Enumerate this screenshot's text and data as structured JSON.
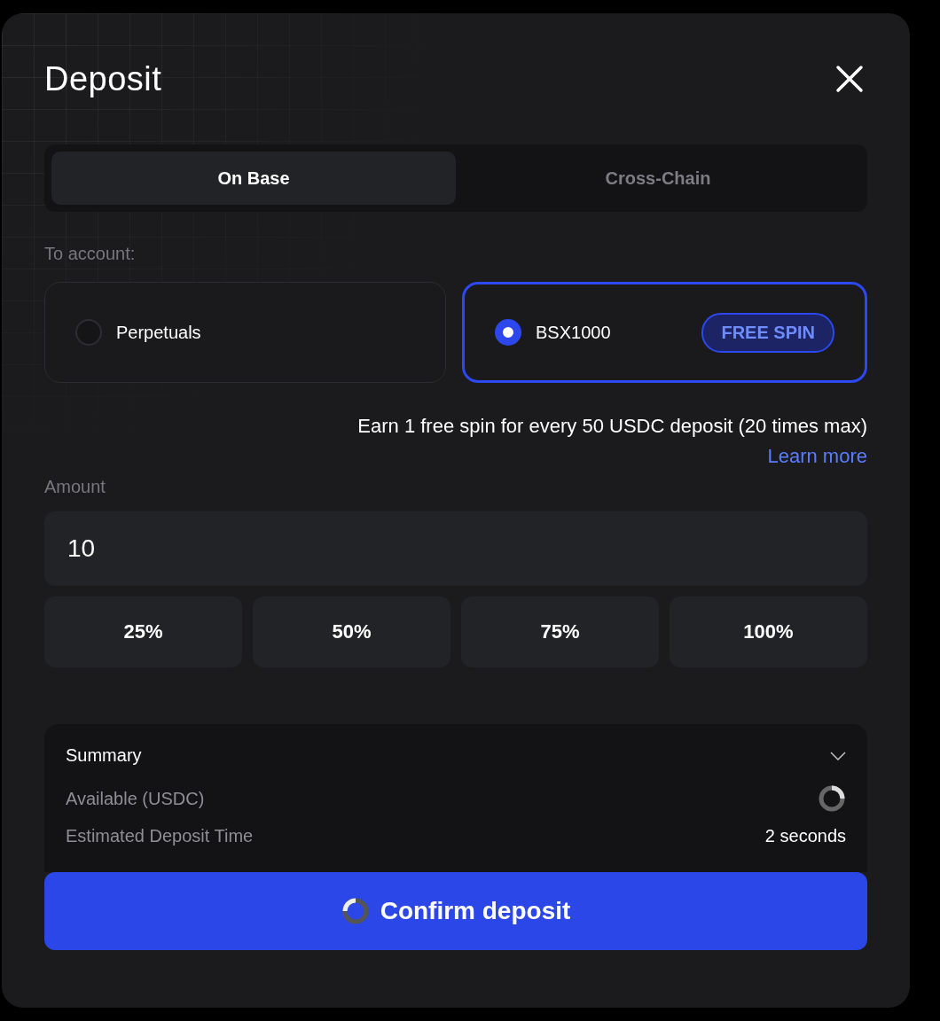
{
  "dialog": {
    "title": "Deposit"
  },
  "tabs": [
    {
      "label": "On Base",
      "selected": true
    },
    {
      "label": "Cross-Chain",
      "selected": false
    }
  ],
  "account": {
    "label": "To account:",
    "options": [
      {
        "label": "Perpetuals",
        "selected": false
      },
      {
        "label": "BSX1000",
        "selected": true,
        "badge": "FREE SPIN"
      }
    ]
  },
  "promo": {
    "text": "Earn 1 free spin for every 50 USDC deposit (20 times max)",
    "link": "Learn more"
  },
  "amount": {
    "label": "Amount",
    "value": "10"
  },
  "percent_buttons": [
    "25%",
    "50%",
    "75%",
    "100%"
  ],
  "summary": {
    "title": "Summary",
    "expanded": true,
    "rows": [
      {
        "label": "Available (USDC)",
        "kind": "loading"
      },
      {
        "label": "Estimated Deposit Time",
        "kind": "text",
        "value": "2 seconds"
      }
    ]
  },
  "confirm": {
    "label": "Confirm deposit",
    "loading": true
  }
}
